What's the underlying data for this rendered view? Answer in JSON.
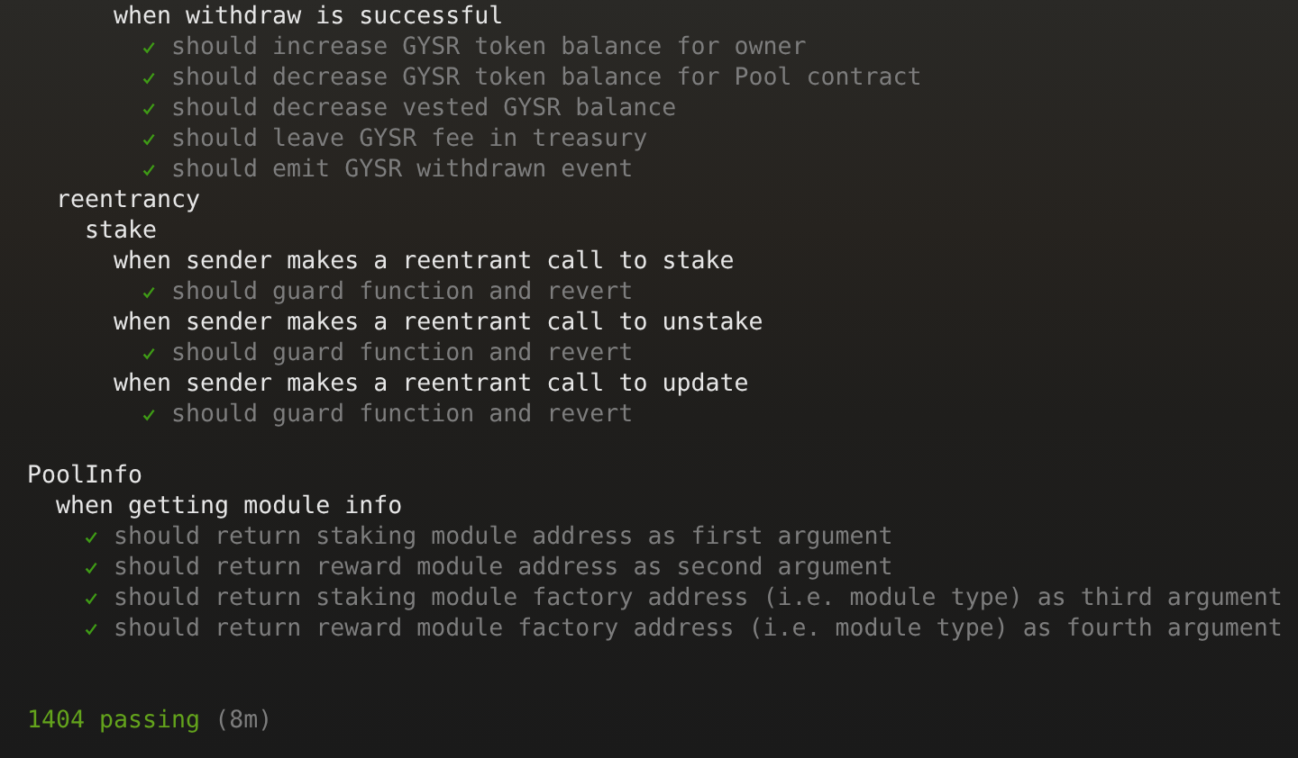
{
  "suites": [
    {
      "kind": "suite",
      "children": [
        {
          "kind": "suite",
          "children": [
            {
              "kind": "suite",
              "children": [
                {
                  "kind": "suite",
                  "title": "when withdraw is successful",
                  "children": [
                    {
                      "kind": "test",
                      "title": "should increase GYSR token balance for owner",
                      "passed": true
                    },
                    {
                      "kind": "test",
                      "title": "should decrease GYSR token balance for Pool contract",
                      "passed": true
                    },
                    {
                      "kind": "test",
                      "title": "should decrease vested GYSR balance",
                      "passed": true
                    },
                    {
                      "kind": "test",
                      "title": "should leave GYSR fee in treasury",
                      "passed": true
                    },
                    {
                      "kind": "test",
                      "title": "should emit GYSR withdrawn event",
                      "passed": true
                    }
                  ]
                }
              ]
            }
          ]
        },
        {
          "kind": "suite",
          "title": "reentrancy",
          "children": [
            {
              "kind": "suite",
              "title": "stake",
              "children": [
                {
                  "kind": "suite",
                  "title": "when sender makes a reentrant call to stake",
                  "children": [
                    {
                      "kind": "test",
                      "title": "should guard function and revert",
                      "passed": true
                    }
                  ]
                },
                {
                  "kind": "suite",
                  "title": "when sender makes a reentrant call to unstake",
                  "children": [
                    {
                      "kind": "test",
                      "title": "should guard function and revert",
                      "passed": true
                    }
                  ]
                },
                {
                  "kind": "suite",
                  "title": "when sender makes a reentrant call to update",
                  "children": [
                    {
                      "kind": "test",
                      "title": "should guard function and revert",
                      "passed": true
                    }
                  ]
                }
              ]
            }
          ]
        }
      ]
    },
    {
      "kind": "suite",
      "title": "PoolInfo",
      "children": [
        {
          "kind": "suite",
          "title": "when getting module info",
          "children": [
            {
              "kind": "test",
              "title": "should return staking module address as first argument",
              "passed": true
            },
            {
              "kind": "test",
              "title": "should return reward module address as second argument",
              "passed": true
            },
            {
              "kind": "test",
              "title": "should return staking module factory address (i.e. module type) as third argument",
              "passed": true
            },
            {
              "kind": "test",
              "title": "should return reward module factory address (i.e. module type) as fourth argument",
              "passed": true
            }
          ]
        }
      ]
    }
  ],
  "summary": {
    "passing": "1404 passing",
    "duration": "(8m)"
  }
}
